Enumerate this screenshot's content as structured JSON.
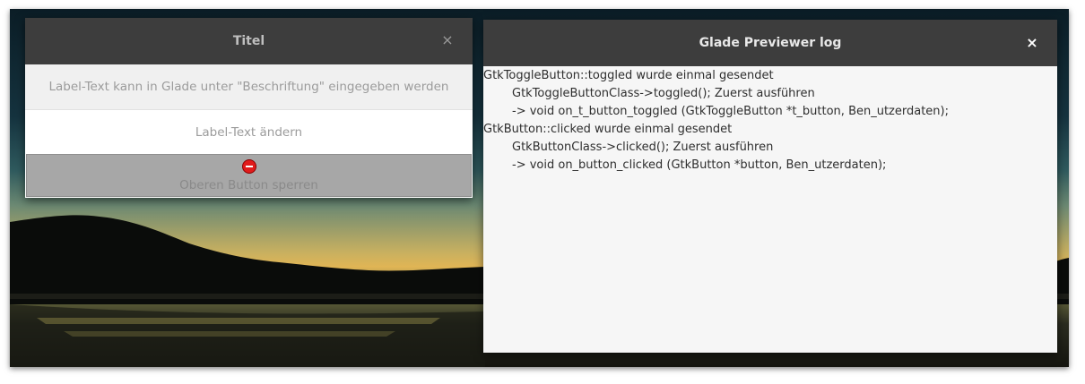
{
  "left_window": {
    "title": "Titel",
    "close_glyph": "×",
    "label_text": "Label-Text kann in Glade unter \"Beschriftung\" eingegeben werden",
    "change_button": "Label-Text ändern",
    "lock_button": "Oberen Button sperren",
    "lock_icon": "stop-icon"
  },
  "right_window": {
    "title": "Glade Previewer log",
    "close_glyph": "×",
    "log_lines": [
      "GtkToggleButton::toggled wurde einmal gesendet",
      "GtkToggleButtonClass->toggled(); Zuerst ausführen",
      "-> void on_t_button_toggled (GtkToggleButton *t_button, Ben_utzerdaten);",
      "GtkButton::clicked wurde einmal gesendet",
      "GtkButtonClass->clicked(); Zuerst ausführen",
      "-> void on_button_clicked (GtkButton *button, Ben_utzerdaten);"
    ]
  },
  "colors": {
    "titlebar": "#3d3d3d",
    "stop_icon": "#e11b1b"
  }
}
